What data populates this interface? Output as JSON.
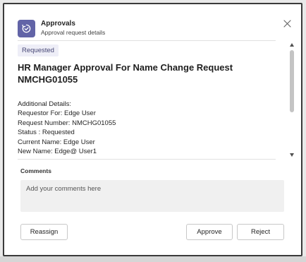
{
  "header": {
    "app_title": "Approvals",
    "app_subtitle": "Approval request details",
    "icon": "approvals-icon",
    "close_icon": "close-icon"
  },
  "card": {
    "status_badge": "Requested",
    "title": "HR Manager Approval For Name Change Request NMCHG01055",
    "details": [
      "Additional Details:",
      "Requestor For: Edge User",
      "Request Number: NMCHG01055",
      "Status : Requested",
      "Current Name: Edge  User",
      "New Name: Edge@  User1"
    ]
  },
  "comments": {
    "label": "Comments",
    "placeholder": "Add your comments here",
    "value": ""
  },
  "actions": {
    "reassign": "Reassign",
    "approve": "Approve",
    "reject": "Reject"
  },
  "colors": {
    "accent": "#6264a7",
    "badge_bg": "#eeeef7",
    "badge_text": "#464775"
  }
}
